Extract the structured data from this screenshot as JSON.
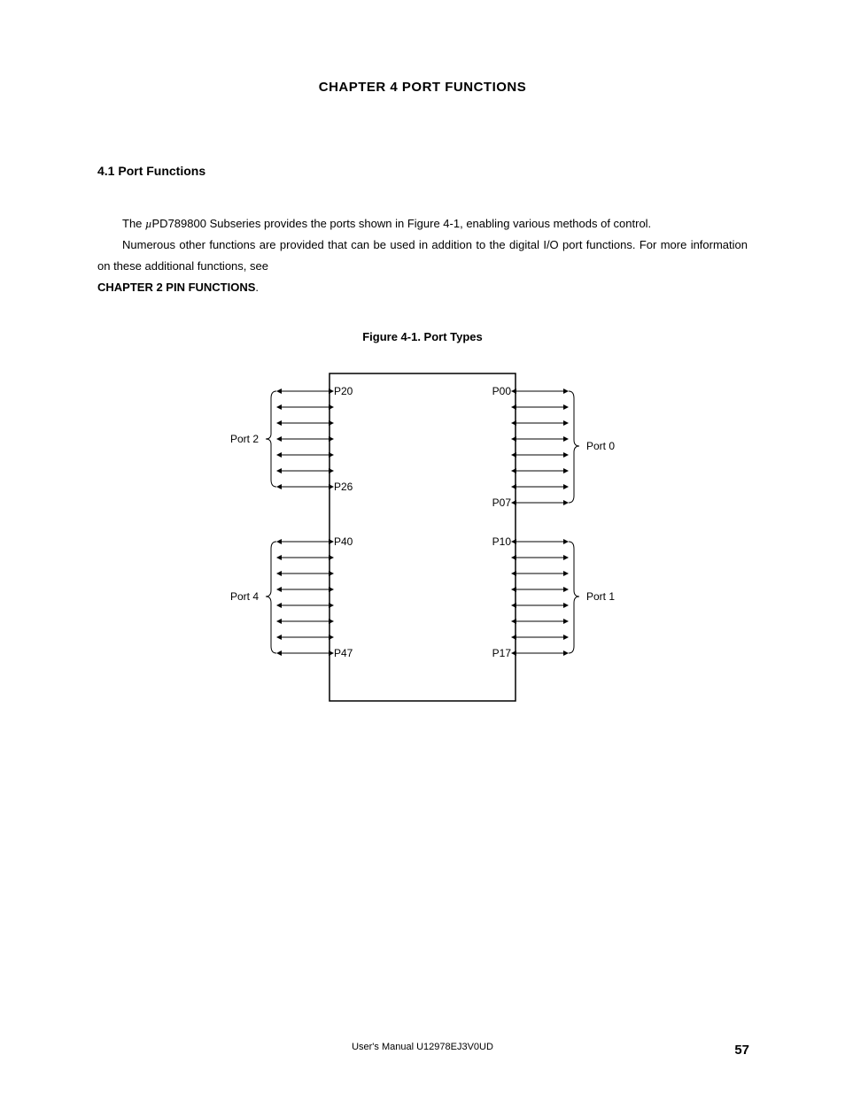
{
  "chapter_title": "CHAPTER  4    PORT  FUNCTIONS",
  "section_title": "4.1   Port Functions",
  "para1_a": "The ",
  "para1_b": "PD789800 Subseries provides the ports shown in Figure 4-1, enabling various methods of control.",
  "para2": "Numerous other functions are provided that can be used in addition to the digital I/O port functions.  For more information on these additional functions, see ",
  "para2_bold": "CHAPTER 2  PIN FUNCTIONS",
  "figure_title": "Figure 4-1.  Port Types",
  "labels": {
    "port2": "Port 2",
    "port4": "Port 4",
    "port0": "Port 0",
    "port1": "Port 1",
    "p20": "P20",
    "p26": "P26",
    "p40": "P40",
    "p47": "P47",
    "p00": "P00",
    "p07": "P07",
    "p10": "P10",
    "p17": "P17"
  },
  "footer": "User's Manual  U12978EJ3V0UD",
  "page": "57"
}
